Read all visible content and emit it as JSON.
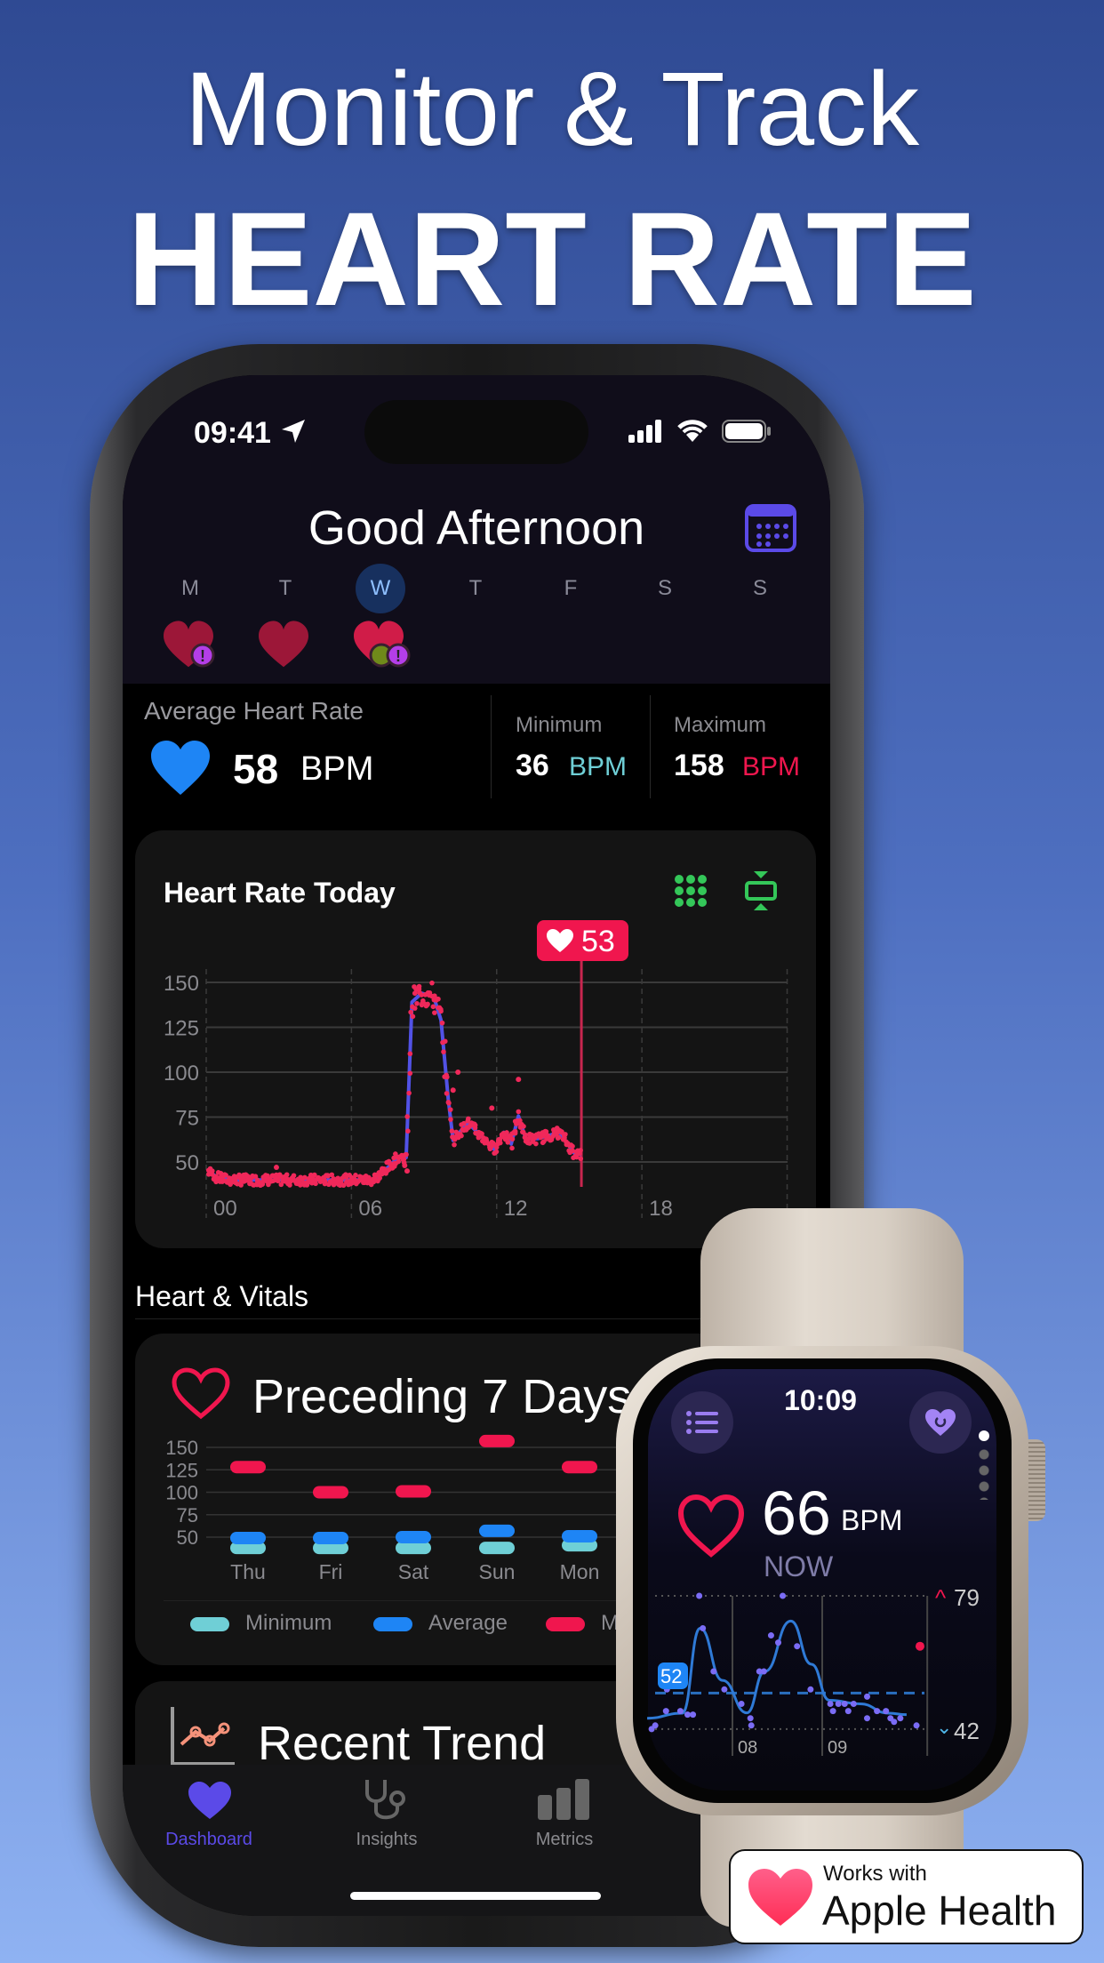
{
  "headline": {
    "line1": "Monitor & Track",
    "line2": "HEART RATE"
  },
  "status_bar": {
    "time": "09:41"
  },
  "header": {
    "greeting": "Good Afternoon",
    "week": [
      {
        "day": "M",
        "heart": true,
        "alert": true,
        "active": false
      },
      {
        "day": "T",
        "heart": true,
        "alert": false,
        "active": false
      },
      {
        "day": "W",
        "heart": true,
        "alert": true,
        "active": true
      },
      {
        "day": "T",
        "heart": false
      },
      {
        "day": "F",
        "heart": false
      },
      {
        "day": "S",
        "heart": false
      },
      {
        "day": "S",
        "heart": false
      }
    ]
  },
  "summary": {
    "avg_label": "Average Heart Rate",
    "avg_value": "58",
    "avg_unit": "BPM",
    "min_label": "Minimum",
    "min_value": "36",
    "min_unit": "BPM",
    "max_label": "Maximum",
    "max_value": "158",
    "max_unit": "BPM"
  },
  "colors": {
    "accent": "#5b4ae8",
    "heart_red": "#f0164e",
    "min": "#6fcfd6",
    "avg": "#1e85f5",
    "line": "#5252e6",
    "green": "#34c759"
  },
  "today_card": {
    "title": "Heart Rate Today",
    "selected_value": "53"
  },
  "section_title": "Heart & Vitals",
  "week_card": {
    "title": "Preceding 7 Days",
    "legend": [
      "Minimum",
      "Average",
      "M"
    ]
  },
  "trend_card": {
    "title": "Recent Trend"
  },
  "tabbar": [
    {
      "label": "Dashboard",
      "active": true
    },
    {
      "label": "Insights"
    },
    {
      "label": "Metrics"
    }
  ],
  "watch": {
    "time": "10:09",
    "bpm": "66",
    "unit": "BPM",
    "now_label": "NOW",
    "high": "79",
    "low": "42",
    "avg_badge": "52",
    "x_labels": [
      "08",
      "09"
    ]
  },
  "badge": {
    "line1": "Works with",
    "line2": "Apple Health"
  },
  "chart_data": [
    {
      "type": "line",
      "title": "Heart Rate Today",
      "ylim": [
        35,
        155
      ],
      "xlim": [
        0,
        24
      ],
      "yticks": [
        "150",
        "125",
        "100",
        "75",
        "50"
      ],
      "ytick_values": [
        150,
        125,
        100,
        75,
        50
      ],
      "xticks": [
        "00",
        "06",
        "12",
        "18"
      ],
      "xtick_values": [
        0,
        6,
        12,
        18
      ],
      "grid": true,
      "cursor_hour": 15.5,
      "line": [
        [
          0.1,
          45
        ],
        [
          0.5,
          41
        ],
        [
          1,
          40
        ],
        [
          3,
          40
        ],
        [
          5,
          40
        ],
        [
          6.9,
          40
        ],
        [
          7.6,
          48
        ],
        [
          7.9,
          52.5
        ],
        [
          8.26,
          52.5
        ],
        [
          8.5,
          139
        ],
        [
          8.9,
          144
        ],
        [
          9.4,
          142
        ],
        [
          9.7,
          129
        ],
        [
          10.0,
          85
        ],
        [
          10.2,
          62
        ],
        [
          10.8,
          72
        ],
        [
          11.9,
          57
        ],
        [
          12.3,
          66.5
        ],
        [
          12.6,
          60
        ],
        [
          12.9,
          75.6
        ],
        [
          13.2,
          63
        ],
        [
          13.7,
          63
        ],
        [
          14.6,
          66.5
        ],
        [
          15.2,
          55
        ],
        [
          15.5,
          54
        ]
      ],
      "outliers": [
        [
          12.9,
          96
        ],
        [
          11.8,
          80
        ],
        [
          10.4,
          100
        ],
        [
          10.2,
          90
        ],
        [
          2.9,
          47
        ],
        [
          8.3,
          45
        ],
        [
          8.2,
          48
        ]
      ]
    },
    {
      "type": "range-bar",
      "title": "Preceding 7 Days",
      "categories": [
        "Thu",
        "Fri",
        "Sat",
        "Sun",
        "Mon"
      ],
      "ylim": [
        35,
        155
      ],
      "yticks": [
        "150",
        "125",
        "100",
        "75",
        "50"
      ],
      "ytick_values": [
        150,
        125,
        100,
        75,
        50
      ],
      "series": [
        {
          "name": "Minimum",
          "values": [
            38,
            38,
            38,
            38,
            41
          ]
        },
        {
          "name": "Average",
          "values": [
            49,
            49,
            50,
            57,
            51
          ]
        },
        {
          "name": "M",
          "values": [
            128,
            100,
            101,
            157,
            128
          ]
        }
      ]
    },
    {
      "type": "line",
      "title": "",
      "ylim": [
        42,
        79
      ],
      "xticks": [
        "08",
        "09"
      ],
      "xtick_values": [
        8,
        9
      ],
      "average": 52,
      "line": [
        [
          7.05,
          45
        ],
        [
          7.44,
          46.4
        ],
        [
          7.64,
          70
        ],
        [
          7.89,
          55.5
        ],
        [
          8.16,
          46.5
        ],
        [
          8.36,
          58
        ],
        [
          8.65,
          72
        ],
        [
          8.88,
          60
        ],
        [
          9.08,
          50
        ],
        [
          9.42,
          49
        ],
        [
          9.74,
          46.4
        ],
        [
          9.94,
          46
        ]
      ],
      "points": [
        [
          7.1,
          42
        ],
        [
          7.14,
          43
        ],
        [
          7.26,
          47
        ],
        [
          7.27,
          53
        ],
        [
          7.42,
          47
        ],
        [
          7.5,
          46
        ],
        [
          7.56,
          46
        ],
        [
          7.63,
          79
        ],
        [
          7.67,
          70
        ],
        [
          7.79,
          58
        ],
        [
          7.91,
          53
        ],
        [
          8.1,
          49
        ],
        [
          8.2,
          45
        ],
        [
          8.21,
          43
        ],
        [
          8.3,
          58
        ],
        [
          8.35,
          58
        ],
        [
          8.43,
          68
        ],
        [
          8.51,
          66
        ],
        [
          8.56,
          79
        ],
        [
          8.72,
          65
        ],
        [
          8.87,
          53
        ],
        [
          9.09,
          49
        ],
        [
          9.12,
          47
        ],
        [
          9.18,
          49
        ],
        [
          9.25,
          49
        ],
        [
          9.29,
          47
        ],
        [
          9.35,
          49
        ],
        [
          9.5,
          51
        ],
        [
          9.5,
          45
        ],
        [
          9.61,
          47
        ],
        [
          9.71,
          47
        ],
        [
          9.76,
          45
        ],
        [
          9.8,
          44
        ],
        [
          9.87,
          45
        ],
        [
          10.05,
          43
        ]
      ],
      "current": [
        9.99,
        65
      ]
    }
  ]
}
